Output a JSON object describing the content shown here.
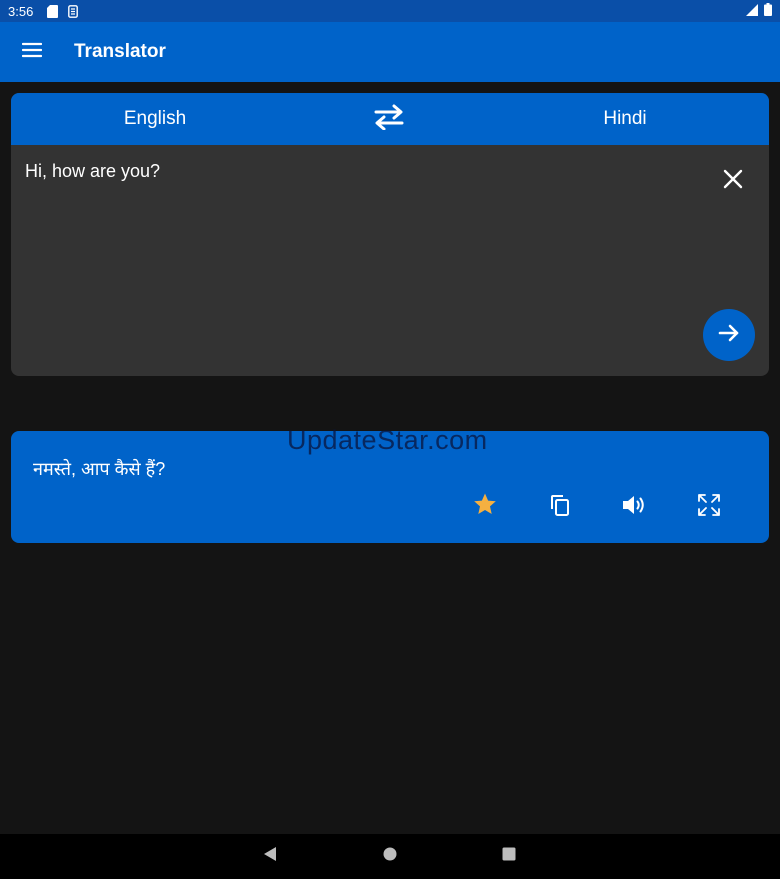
{
  "status_bar": {
    "time": "3:56",
    "icons": [
      "sd-card-icon",
      "sim-icon"
    ],
    "right_icons": [
      "signal-icon",
      "battery-icon"
    ]
  },
  "app_bar": {
    "title": "Translator",
    "menu_icon": "menu-icon"
  },
  "languages": {
    "source": "English",
    "target": "Hindi",
    "swap_icon": "swap-icon"
  },
  "input": {
    "text": "Hi, how are you?",
    "clear_icon": "close-icon",
    "translate_icon": "arrow-right-icon"
  },
  "output": {
    "text": "नमस्ते, आप कैसे हैं?",
    "actions": [
      "star-icon",
      "copy-icon",
      "speaker-icon",
      "fullscreen-icon"
    ]
  },
  "watermark": "UpdateStar.com",
  "nav_bar": {
    "icons": [
      "back-icon",
      "home-icon",
      "recents-icon"
    ]
  },
  "colors": {
    "primary": "#0063c9",
    "status_bar": "#0a4fa8",
    "background": "#141414",
    "input_card": "#333333",
    "star": "#f5b041"
  }
}
